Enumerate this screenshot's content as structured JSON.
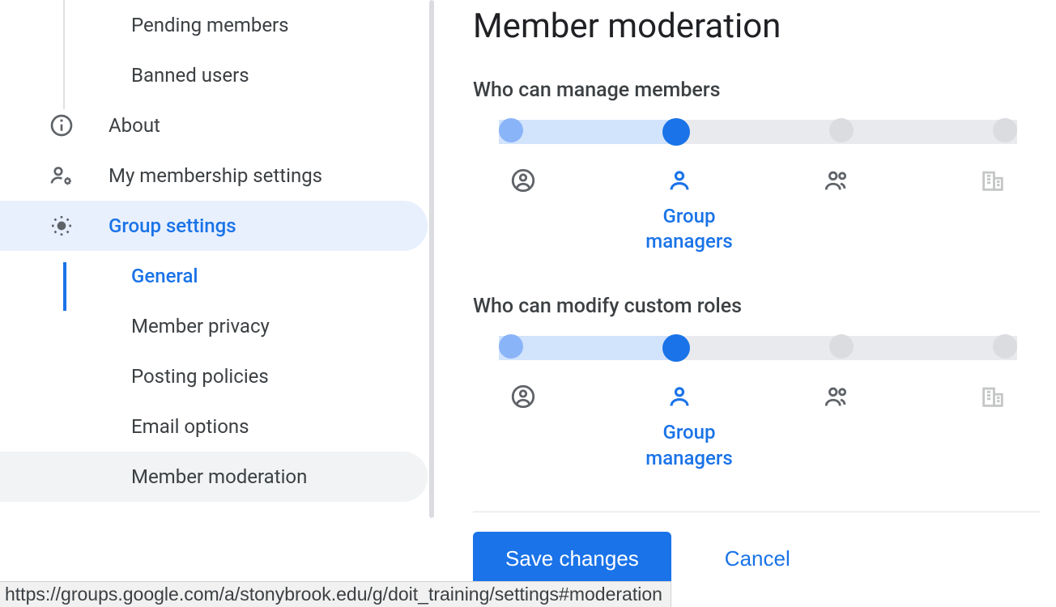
{
  "sidebar": {
    "pending_members": "Pending members",
    "banned_users": "Banned users",
    "about": "About",
    "membership": "My membership settings",
    "group_settings": "Group settings",
    "general": "General",
    "member_privacy": "Member privacy",
    "posting_policies": "Posting policies",
    "email_options": "Email options",
    "member_moderation": "Member moderation"
  },
  "main": {
    "title": "Member moderation",
    "setting1": {
      "label": "Who can manage members",
      "selected": "Group managers"
    },
    "setting2": {
      "label": "Who can modify custom roles",
      "selected": "Group managers"
    },
    "save": "Save changes",
    "cancel": "Cancel"
  },
  "statusbar": "https://groups.google.com/a/stonybrook.edu/g/doit_training/settings#moderation"
}
